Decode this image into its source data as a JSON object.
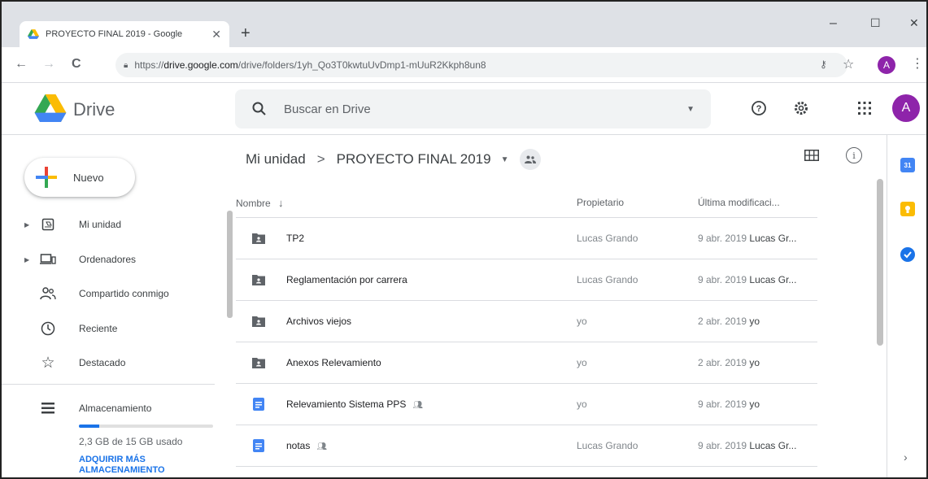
{
  "browser": {
    "tab_title": "PROYECTO FINAL 2019 - Google",
    "tab_close": "✕",
    "new_tab": "+",
    "url_prefix": "https://",
    "url_domain": "drive.google.com",
    "url_path": "/drive/folders/1yh_Qo3T0kwtuUvDmp1-mUuR2Kkph8un8",
    "profile_initial": "A",
    "window_controls": {
      "minimize": "–",
      "maximize": "☐",
      "close": "✕"
    },
    "nav": {
      "back": "←",
      "forward": "→",
      "reload": "C"
    }
  },
  "header": {
    "brand": "Drive",
    "search_placeholder": "Buscar en Drive",
    "avatar_initial": "A",
    "icons": [
      "search-icon",
      "help-icon",
      "settings-icon",
      "apps-grid-icon"
    ]
  },
  "sidebar": {
    "new_label": "Nuevo",
    "items": [
      {
        "label": "Mi unidad",
        "icon": "my-drive-icon",
        "expandable": true
      },
      {
        "label": "Ordenadores",
        "icon": "computers-icon",
        "expandable": true
      },
      {
        "label": "Compartido conmigo",
        "icon": "shared-with-me-icon",
        "expandable": false
      },
      {
        "label": "Reciente",
        "icon": "clock-icon",
        "expandable": false
      },
      {
        "label": "Destacado",
        "icon": "star-icon",
        "expandable": false
      }
    ],
    "storage": {
      "label": "Almacenamiento",
      "usage_text": "2,3 GB de 15 GB usado",
      "used_gb": 2.3,
      "total_gb": 15,
      "buy_more": "ADQUIRIR MÁS ALMACENAMIENTO"
    }
  },
  "breadcrumb": {
    "root": "Mi unidad",
    "separator": ">",
    "current": "PROYECTO FINAL 2019"
  },
  "list": {
    "columns": {
      "name": "Nombre",
      "owner": "Propietario",
      "modified": "Última modificaci..."
    },
    "sort_arrow": "↓",
    "rows": [
      {
        "type": "shared-folder",
        "name": "TP2",
        "shared": false,
        "owner": "Lucas Grando",
        "date": "9 abr. 2019",
        "by": "Lucas Gr..."
      },
      {
        "type": "shared-folder",
        "name": "Reglamentación por carrera",
        "shared": false,
        "owner": "Lucas Grando",
        "date": "9 abr. 2019",
        "by": "Lucas Gr..."
      },
      {
        "type": "shared-folder",
        "name": "Archivos viejos",
        "shared": false,
        "owner": "yo",
        "date": "2 abr. 2019",
        "by": "yo"
      },
      {
        "type": "shared-folder",
        "name": "Anexos Relevamiento",
        "shared": false,
        "owner": "yo",
        "date": "2 abr. 2019",
        "by": "yo"
      },
      {
        "type": "doc",
        "name": "Relevamiento Sistema PPS",
        "shared": true,
        "owner": "yo",
        "date": "9 abr. 2019",
        "by": "yo"
      },
      {
        "type": "doc",
        "name": "notas",
        "shared": true,
        "owner": "Lucas Grando",
        "date": "9 abr. 2019",
        "by": "Lucas Gr..."
      }
    ]
  },
  "colors": {
    "accent": "#1a73e8",
    "avatar": "#8e24aa",
    "folder": "#5f6368",
    "doc": "#4285f4"
  }
}
